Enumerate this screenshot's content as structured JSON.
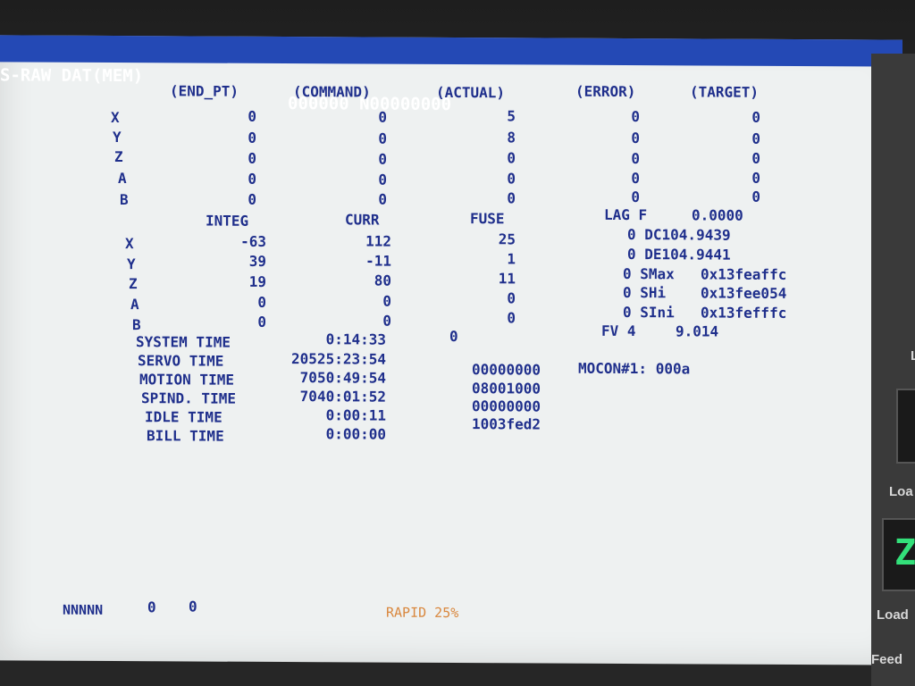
{
  "title": {
    "left": "S-RAW DAT(MEM)",
    "right": "000000 N00000000"
  },
  "headers1": [
    "(END_PT)",
    "(COMMAND)",
    "(ACTUAL)",
    "(ERROR)",
    "(TARGET)"
  ],
  "axes": [
    "X",
    "Y",
    "Z",
    "A",
    "B"
  ],
  "table1": [
    [
      "0",
      "0",
      "5",
      "0",
      "0"
    ],
    [
      "0",
      "0",
      "8",
      "0",
      "0"
    ],
    [
      "0",
      "0",
      "0",
      "0",
      "0"
    ],
    [
      "0",
      "0",
      "0",
      "0",
      "0"
    ],
    [
      "0",
      "0",
      "0",
      "0",
      "0"
    ]
  ],
  "headers2": [
    "INTEG",
    "CURR",
    "FUSE"
  ],
  "table2": [
    [
      "-63",
      "112",
      "25"
    ],
    [
      "39",
      "-11",
      "1"
    ],
    [
      "19",
      "80",
      "11"
    ],
    [
      "0",
      "0",
      "0"
    ],
    [
      "0",
      "0",
      "0"
    ]
  ],
  "right_info": [
    {
      "a": "LAG F",
      "b": "0.0000"
    },
    {
      "a": "0 DC104.9439",
      "b": ""
    },
    {
      "a": "0 DE104.9441",
      "b": ""
    },
    {
      "a": "0 SMax",
      "b": "0x13feaffc"
    },
    {
      "a": "0 SHi",
      "b": "0x13fee054"
    },
    {
      "a": "0 SIni",
      "b": "0x13fefffc"
    }
  ],
  "fv": {
    "label": "FV 4",
    "value": "9.014"
  },
  "times": [
    {
      "label": "SYSTEM TIME",
      "value": "0:14:33"
    },
    {
      "label": "SERVO TIME",
      "value": "20525:23:54"
    },
    {
      "label": "MOTION TIME",
      "value": "7050:49:54"
    },
    {
      "label": "SPIND. TIME",
      "value": "7040:01:52"
    },
    {
      "label": "IDLE TIME",
      "value": "0:00:11"
    },
    {
      "label": "BILL TIME",
      "value": "0:00:00"
    }
  ],
  "system_time_extra": "0",
  "hex_values": [
    "00000000",
    "08001000",
    "00000000",
    "1003fed2"
  ],
  "mocon": "MOCON#1: 000a",
  "footer": {
    "nnnnn": "NNNNN",
    "n1": "0",
    "n2": "0",
    "rapid": "RAPID 25%"
  },
  "side": {
    "l1": "L",
    "l2": "Loa",
    "l3": "Load",
    "l4": "Feed",
    "digit": "Z"
  },
  "colors": {
    "screen_bg": "#eef1f1",
    "text": "#1f2f8c",
    "title_bar": "#2449b5",
    "rapid": "#d9873d"
  }
}
